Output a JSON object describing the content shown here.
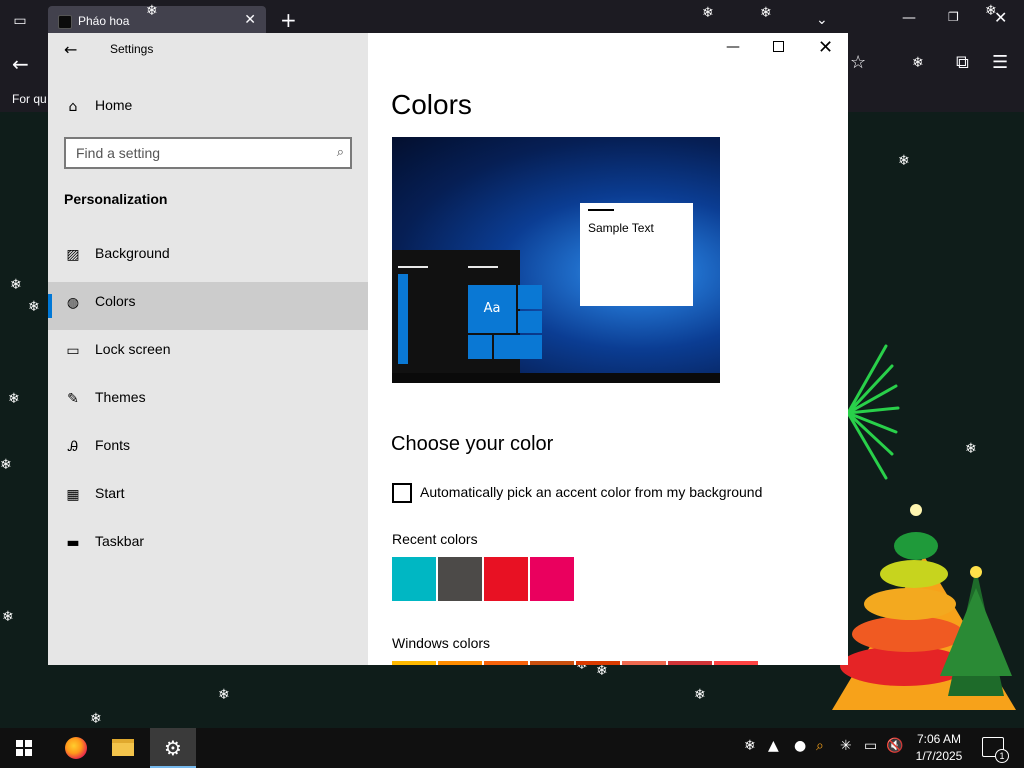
{
  "browser": {
    "tab_title": "Pháo hoa",
    "tab_close_icon": "✕",
    "new_tab_icon": "+",
    "bookmark_text": "For qu"
  },
  "settings": {
    "app_title": "Settings",
    "home_label": "Home",
    "search_placeholder": "Find a setting",
    "section_label": "Personalization",
    "nav": [
      {
        "label": "Background",
        "icon": "picture-icon"
      },
      {
        "label": "Colors",
        "icon": "palette-icon",
        "selected": true
      },
      {
        "label": "Lock screen",
        "icon": "lock-screen-icon"
      },
      {
        "label": "Themes",
        "icon": "brush-icon"
      },
      {
        "label": "Fonts",
        "icon": "font-icon"
      },
      {
        "label": "Start",
        "icon": "start-grid-icon"
      },
      {
        "label": "Taskbar",
        "icon": "taskbar-icon"
      }
    ],
    "page_title": "Colors",
    "preview": {
      "sample_text": "Sample Text",
      "tile_text": "Aa"
    },
    "choose_title": "Choose your color",
    "auto_pick_label": "Automatically pick an accent color from my background",
    "auto_pick_checked": false,
    "recent_label": "Recent colors",
    "recent_colors": [
      "#00b7c3",
      "#4c4a48",
      "#e81123",
      "#ea005e"
    ],
    "windows_label": "Windows colors",
    "windows_colors": [
      "#ffb900",
      "#ff8c00",
      "#f7630c",
      "#ca5010",
      "#da3b01",
      "#ef6950",
      "#d13438",
      "#ff4343"
    ]
  },
  "taskbar": {
    "time": "7:06 AM",
    "date": "1/7/2025",
    "notification_count": "1"
  },
  "accent_color": "#0078d7"
}
